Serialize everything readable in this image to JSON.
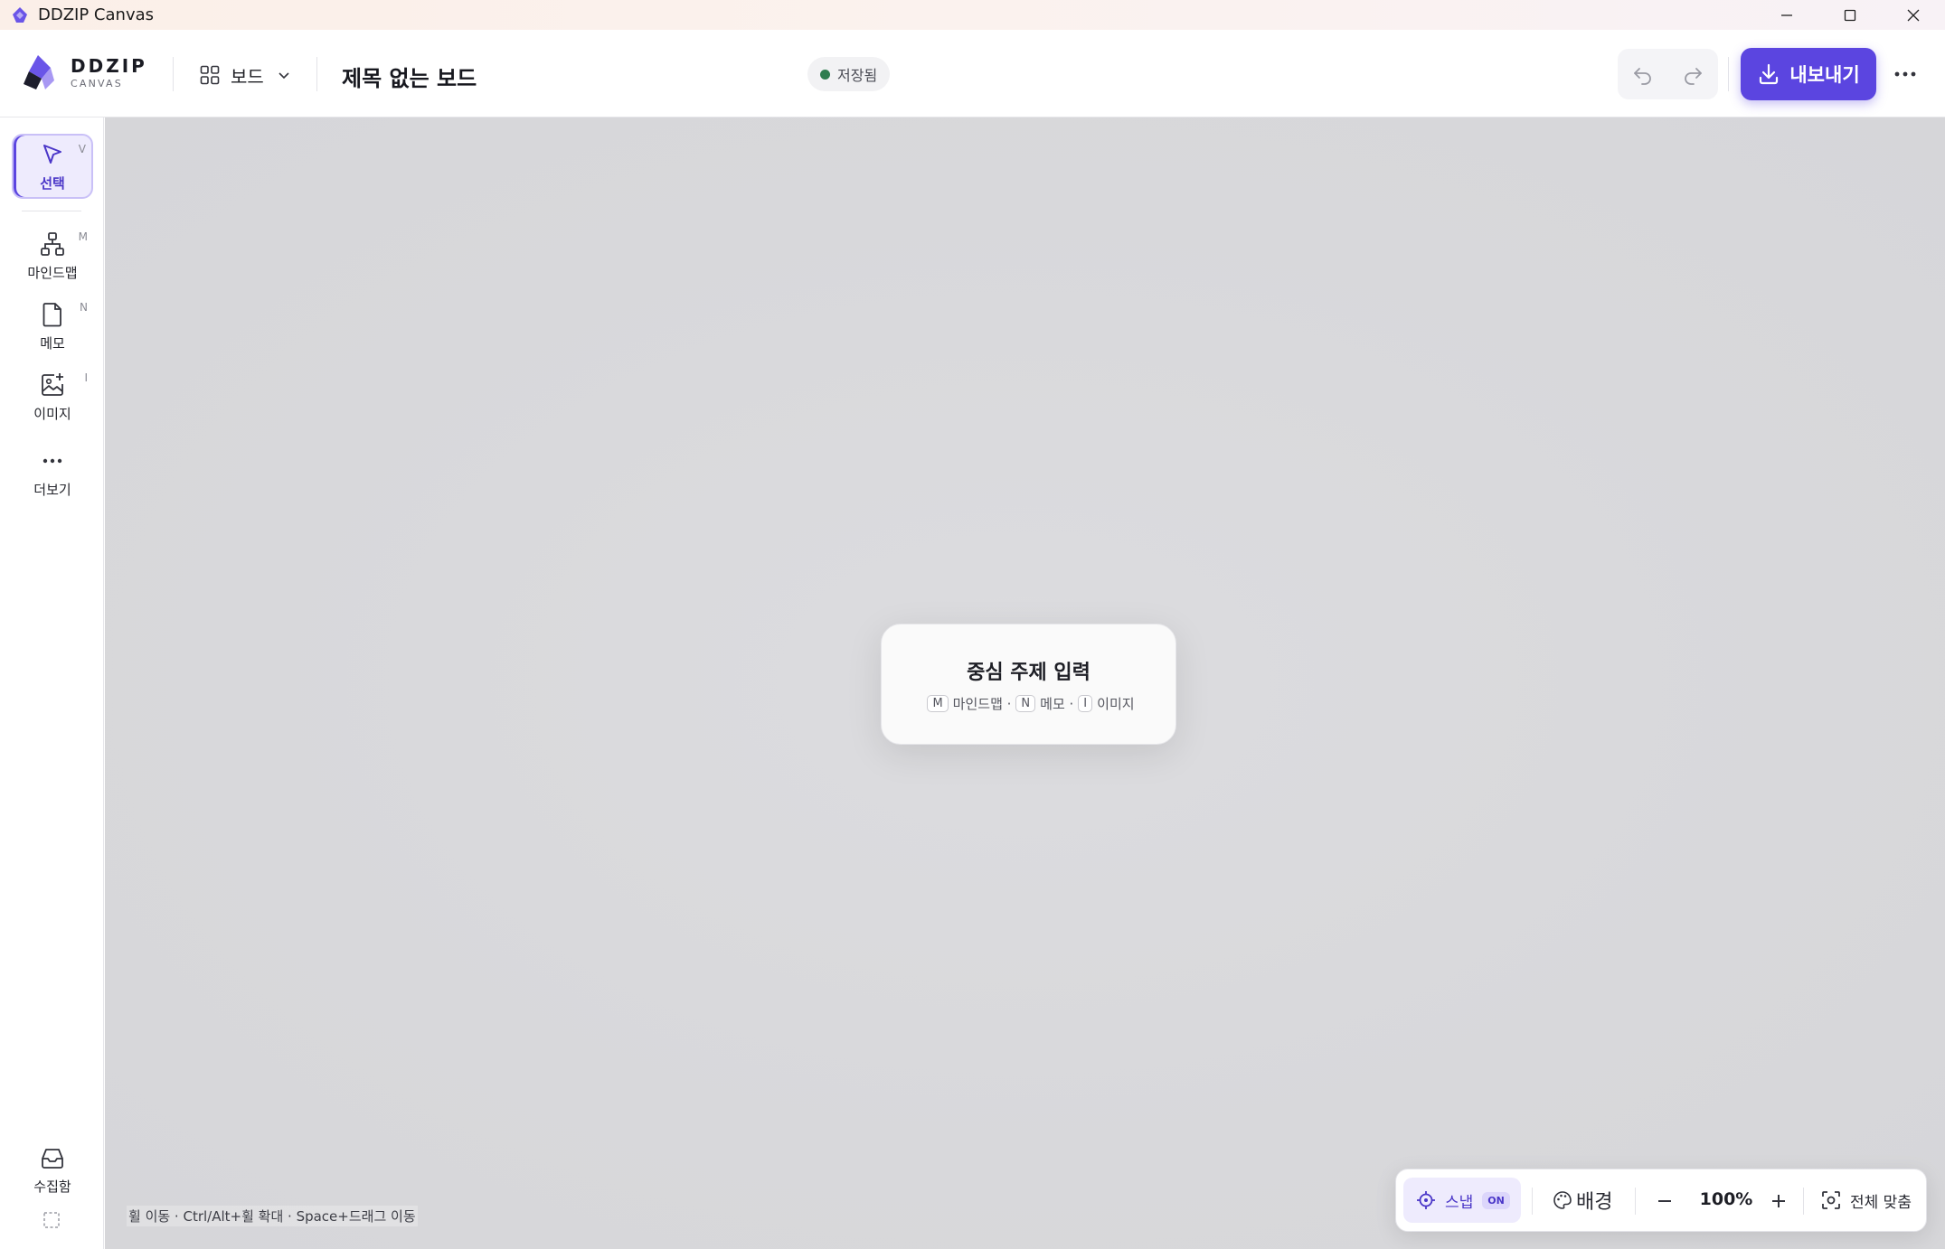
{
  "window": {
    "title": "DDZIP Canvas"
  },
  "header": {
    "logo_main": "DDZIP",
    "logo_sub": "CANVAS",
    "board_switch_label": "보드",
    "board_title": "제목 없는 보드",
    "save_status": "저장됨",
    "export_label": "내보내기"
  },
  "sidebar": {
    "tools": [
      {
        "label": "선택",
        "key": "V"
      },
      {
        "label": "마인드맵",
        "key": "M"
      },
      {
        "label": "메모",
        "key": "N"
      },
      {
        "label": "이미지",
        "key": "I"
      },
      {
        "label": "더보기",
        "key": ""
      }
    ],
    "inbox_label": "수집함"
  },
  "canvas": {
    "node_title": "중심 주제 입력",
    "hint_key_m": "M",
    "hint_mindmap": "마인드맵 ·",
    "hint_key_n": "N",
    "hint_memo": "메모 ·",
    "hint_key_i": "I",
    "hint_image": "이미지",
    "status_hint": "휠 이동 · Ctrl/Alt+휠 확대 · Space+드래그 이동"
  },
  "bottom_bar": {
    "snap_label": "스냅",
    "snap_state": "ON",
    "background_label": "배경",
    "zoom": "100%",
    "fit_label": "전체 맞춤"
  },
  "colors": {
    "accent": "#5b45e0",
    "saved_dot": "#2e7d4f",
    "canvas_bg": "#d8d8db"
  }
}
